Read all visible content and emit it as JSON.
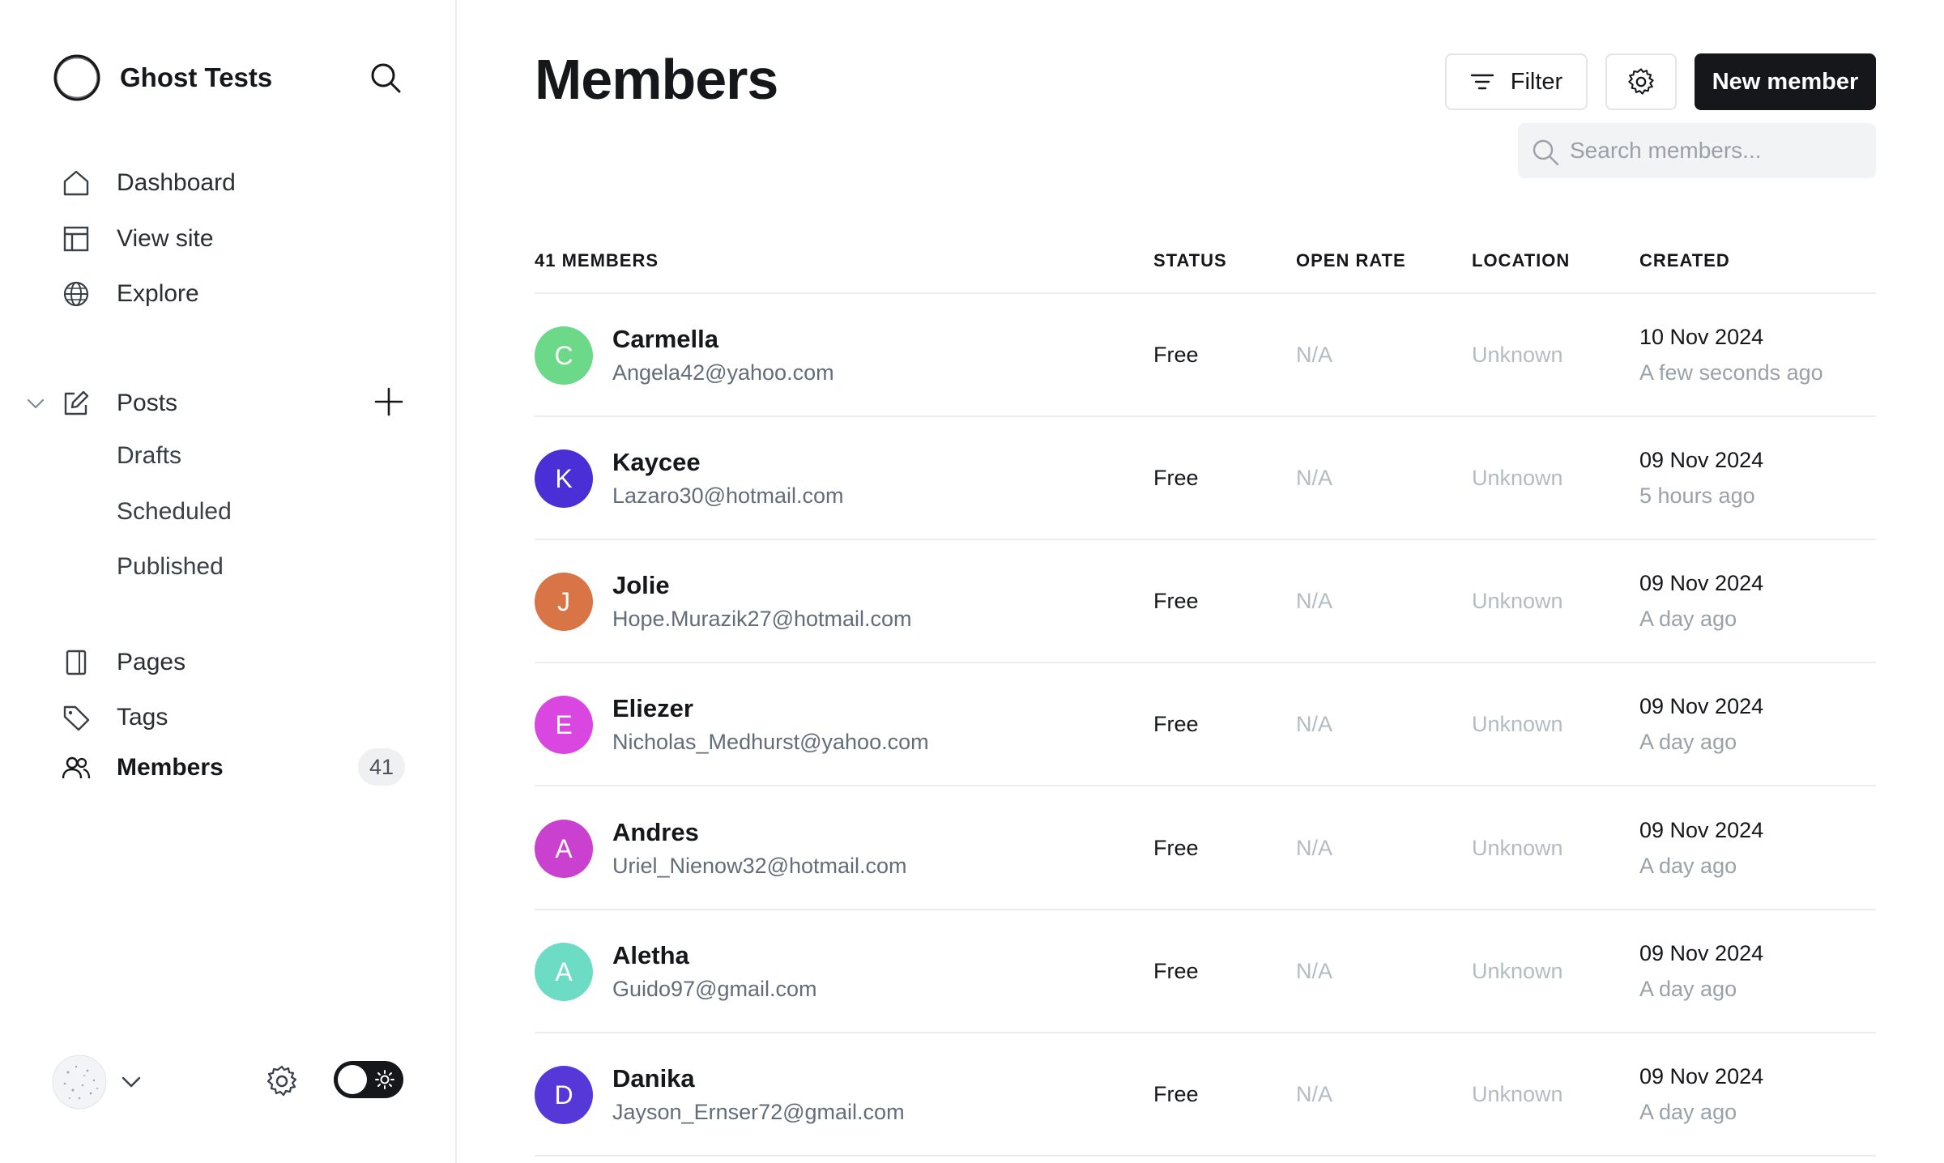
{
  "sidebar": {
    "site_name": "Ghost Tests",
    "nav": [
      {
        "label": "Dashboard",
        "icon": "home-icon"
      },
      {
        "label": "View site",
        "icon": "layout-icon"
      },
      {
        "label": "Explore",
        "icon": "globe-icon"
      }
    ],
    "posts": {
      "label": "Posts",
      "icon": "edit-icon",
      "sub": [
        "Drafts",
        "Scheduled",
        "Published"
      ]
    },
    "nav2": [
      {
        "label": "Pages",
        "icon": "page-icon"
      },
      {
        "label": "Tags",
        "icon": "tag-icon"
      },
      {
        "label": "Members",
        "icon": "members-icon",
        "active": true,
        "count": "41"
      }
    ]
  },
  "main": {
    "title": "Members",
    "filter_label": "Filter",
    "new_member_label": "New member",
    "search_placeholder": "Search members...",
    "table": {
      "headers": [
        "41 MEMBERS",
        "STATUS",
        "OPEN RATE",
        "LOCATION",
        "CREATED"
      ],
      "rows": [
        {
          "initial": "C",
          "color": "#6bd987",
          "name": "Carmella",
          "email": "Angela42@yahoo.com",
          "status": "Free",
          "open_rate": "N/A",
          "location": "Unknown",
          "created": "10 Nov 2024",
          "ago": "A few seconds ago"
        },
        {
          "initial": "K",
          "color": "#4a2ed6",
          "name": "Kaycee",
          "email": "Lazaro30@hotmail.com",
          "status": "Free",
          "open_rate": "N/A",
          "location": "Unknown",
          "created": "09 Nov 2024",
          "ago": "5 hours ago"
        },
        {
          "initial": "J",
          "color": "#d87445",
          "name": "Jolie",
          "email": "Hope.Murazik27@hotmail.com",
          "status": "Free",
          "open_rate": "N/A",
          "location": "Unknown",
          "created": "09 Nov 2024",
          "ago": "A day ago"
        },
        {
          "initial": "E",
          "color": "#d946e0",
          "name": "Eliezer",
          "email": "Nicholas_Medhurst@yahoo.com",
          "status": "Free",
          "open_rate": "N/A",
          "location": "Unknown",
          "created": "09 Nov 2024",
          "ago": "A day ago"
        },
        {
          "initial": "A",
          "color": "#cb41cf",
          "name": "Andres",
          "email": "Uriel_Nienow32@hotmail.com",
          "status": "Free",
          "open_rate": "N/A",
          "location": "Unknown",
          "created": "09 Nov 2024",
          "ago": "A day ago"
        },
        {
          "initial": "A",
          "color": "#6ddcc4",
          "name": "Aletha",
          "email": "Guido97@gmail.com",
          "status": "Free",
          "open_rate": "N/A",
          "location": "Unknown",
          "created": "09 Nov 2024",
          "ago": "A day ago"
        },
        {
          "initial": "D",
          "color": "#5637d8",
          "name": "Danika",
          "email": "Jayson_Ernser72@gmail.com",
          "status": "Free",
          "open_rate": "N/A",
          "location": "Unknown",
          "created": "09 Nov 2024",
          "ago": "A day ago"
        }
      ]
    }
  }
}
